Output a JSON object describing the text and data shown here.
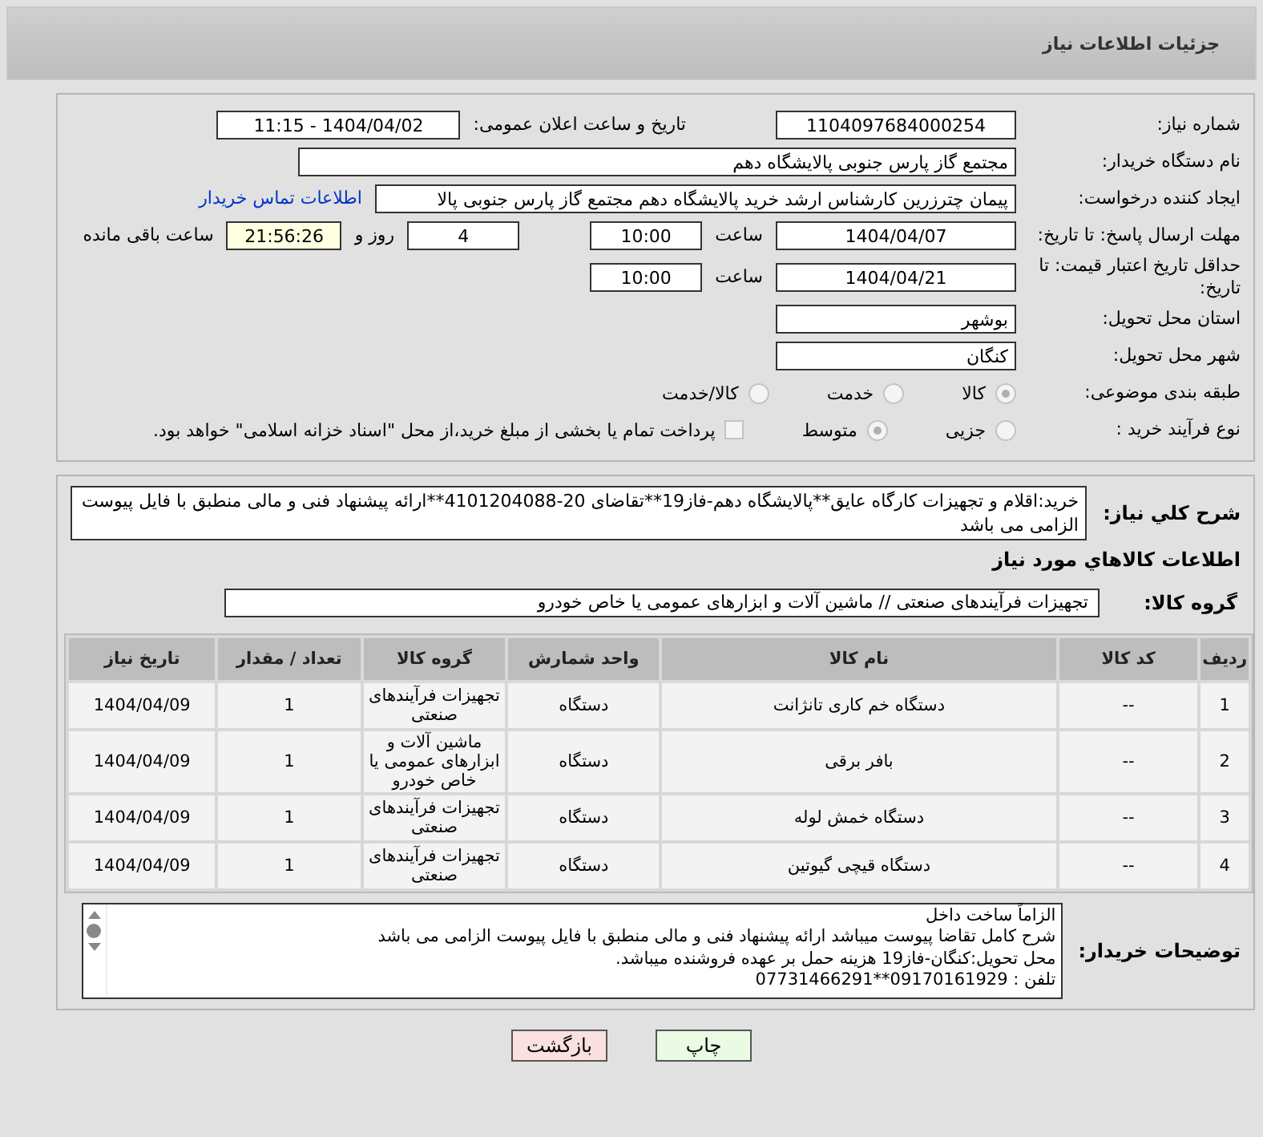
{
  "header": {
    "title": "جزئیات اطلاعات نیاز"
  },
  "need_number": {
    "label": "شماره نیاز:",
    "value": "1104097684000254"
  },
  "announce": {
    "label": "تاریخ و ساعت اعلان عمومی:",
    "value": "1404/04/02 - 11:15"
  },
  "buyer_org": {
    "label": "نام دستگاه خریدار:",
    "value": "مجتمع گاز پارس جنوبی  پالایشگاه دهم"
  },
  "creator": {
    "label": "ایجاد کننده درخواست:",
    "value": "پیمان چترزرین کارشناس ارشد خرید پالایشگاه دهم مجتمع گاز پارس جنوبی  پالا",
    "link": "اطلاعات تماس خریدار"
  },
  "reply_deadline": {
    "label": "مهلت ارسال پاسخ: تا تاریخ:",
    "date": "1404/04/07",
    "time_label": "ساعت",
    "time": "10:00",
    "days": "4",
    "days_label": "روز و",
    "remaining": "21:56:26",
    "remaining_label": "ساعت باقی مانده"
  },
  "price_validity": {
    "label": "حداقل تاریخ اعتبار قیمت: تا تاریخ:",
    "date": "1404/04/21",
    "time_label": "ساعت",
    "time": "10:00"
  },
  "province": {
    "label": "استان محل تحویل:",
    "value": "بوشهر"
  },
  "city": {
    "label": "شهر محل تحویل:",
    "value": "کنگان"
  },
  "category": {
    "label": "طبقه بندی موضوعی:",
    "options": [
      {
        "label": "کالا",
        "selected": true
      },
      {
        "label": "خدمت",
        "selected": false
      },
      {
        "label": "کالا/خدمت",
        "selected": false
      }
    ]
  },
  "process": {
    "label": "نوع فرآیند خرید :",
    "options": [
      {
        "label": "جزیی",
        "selected": false
      },
      {
        "label": "متوسط",
        "selected": true
      }
    ],
    "payment": {
      "checked": false,
      "text": "پرداخت تمام یا بخشی از مبلغ خرید،از محل \"اسناد خزانه اسلامی\" خواهد بود."
    }
  },
  "description": {
    "label": "شرح کلي نياز:",
    "value": "خرید:اقلام و تجهیزات کارگاه عایق**پالایشگاه دهم-فاز19**تقاضای 20-4101204088**ارائه پیشنهاد فنی و مالی منطبق با فایل پیوست الزامی می باشد"
  },
  "goods_heading": "اطلاعات كالاهاي مورد نياز",
  "goods_group": {
    "label": "گروه کالا:",
    "value": "تجهیزات فرآیندهای صنعتی //  ماشین آلات و ابزارهای عمومی یا خاص خودرو"
  },
  "table": {
    "columns": [
      "ردیف",
      "کد کالا",
      "نام کالا",
      "واحد شمارش",
      "گروه کالا",
      "تعداد / مقدار",
      "تاریخ نیاز"
    ],
    "rows": [
      [
        "1",
        "--",
        "دستگاه خم کاری تانژانت",
        "دستگاه",
        "تجهیزات فرآیندهای صنعتی",
        "1",
        "1404/04/09"
      ],
      [
        "2",
        "--",
        "بافر برقی",
        "دستگاه",
        "ماشین آلات و ابزارهای عمومی یا خاص خودرو",
        "1",
        "1404/04/09"
      ],
      [
        "3",
        "--",
        "دستگاه خمش لوله",
        "دستگاه",
        "تجهیزات فرآیندهای صنعتی",
        "1",
        "1404/04/09"
      ],
      [
        "4",
        "--",
        "دستگاه قیچی گیوتین",
        "دستگاه",
        "تجهیزات فرآیندهای صنعتی",
        "1",
        "1404/04/09"
      ]
    ]
  },
  "buyer_notes": {
    "label": "توضیحات خریدار:",
    "lines": [
      "الزاماً ساخت داخل",
      "شرح کامل تقاضا پیوست میباشد ارائه پیشنهاد فنی و مالی منطبق با فایل پیوست الزامی می باشد",
      "محل تحویل:کنگان-فاز19 هزینه حمل بر عهده فروشنده میباشد.",
      "تلفن : 09170161929**07731466291"
    ]
  },
  "buttons": [
    {
      "label": "چاپ",
      "kind": "print"
    },
    {
      "label": "بازگشت",
      "kind": "back"
    }
  ]
}
